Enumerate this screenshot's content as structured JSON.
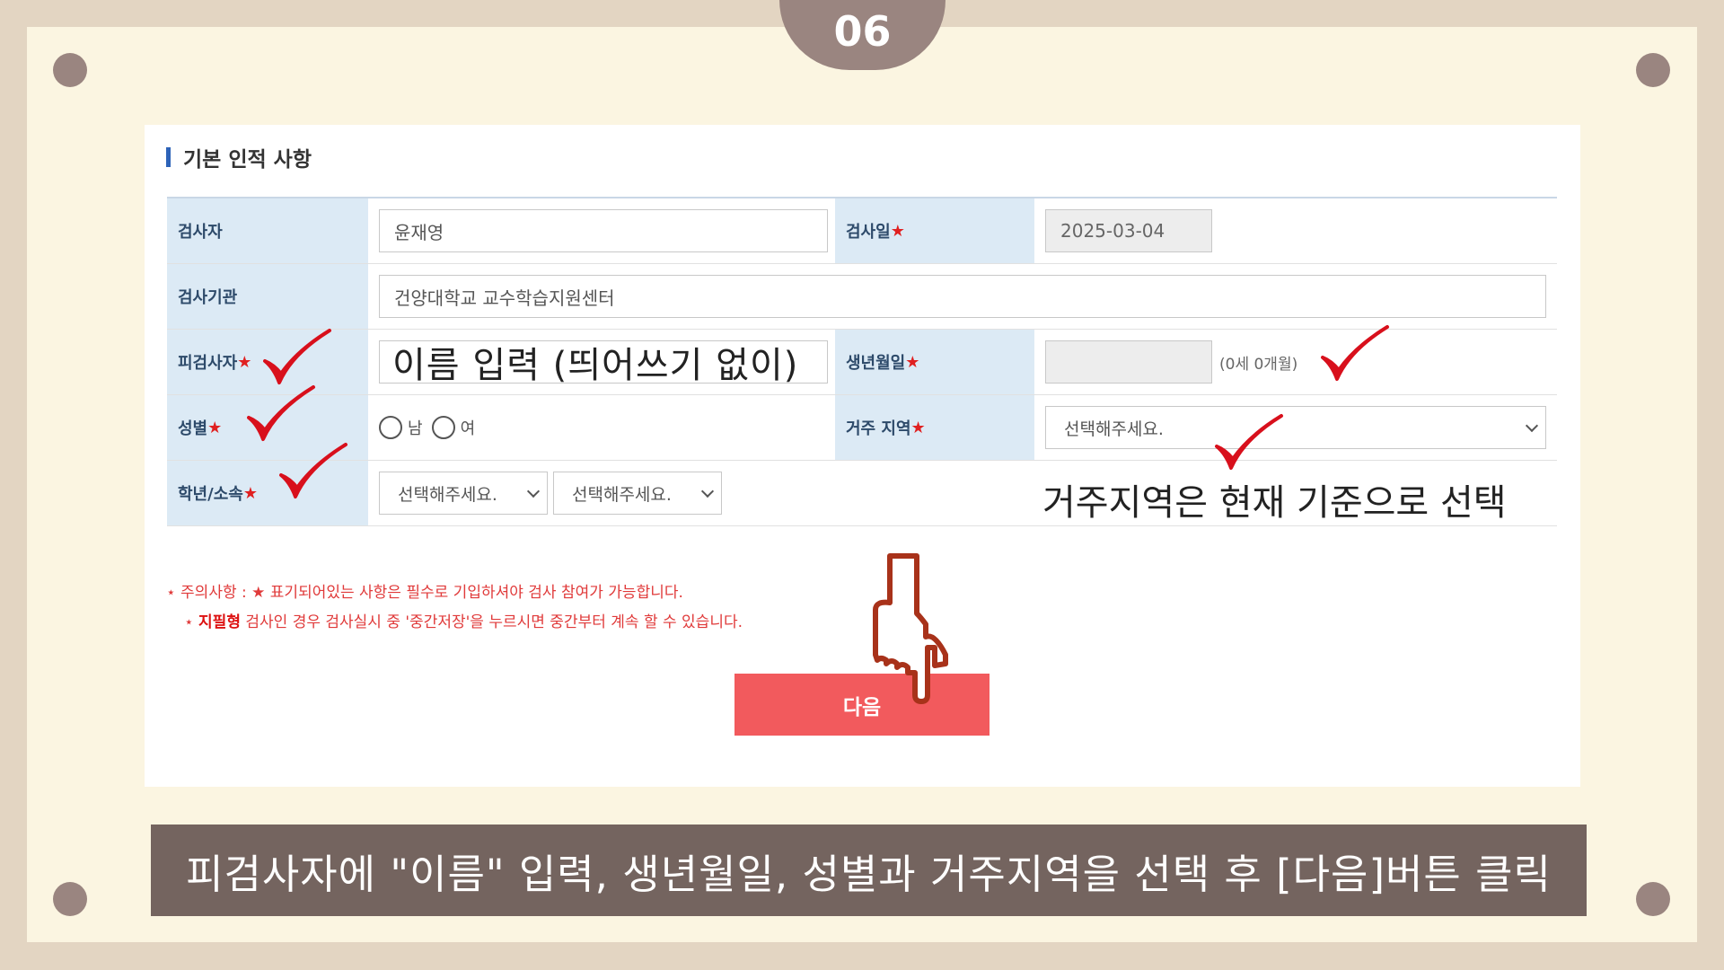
{
  "step_number": "06",
  "section_title": "기본 인적 사항",
  "form": {
    "examiner_label": "검사자",
    "examiner_value": "윤재영",
    "test_date_label": "검사일",
    "test_date_value": "2025-03-04",
    "institution_label": "검사기관",
    "institution_value": "건양대학교 교수학습지원센터",
    "subject_label": "피검사자",
    "subject_value": "이름 입력 (띄어쓰기 없이)",
    "birth_label": "생년월일",
    "birth_value": "",
    "age_text": "(0세 0개월)",
    "gender_label": "성별",
    "gender_options": [
      "남",
      "여"
    ],
    "region_label": "거주 지역",
    "region_selected": "선택해주세요.",
    "grade_label": "학년/소속",
    "grade_select_1": "선택해주세요.",
    "grade_select_2": "선택해주세요.",
    "required_mark": "★"
  },
  "annotation_region": "거주지역은 현재 기준으로 선택",
  "notes": {
    "line1": "⋆ 주의사항 : ★ 표기되어있는 사항은 필수로 기입하셔야 검사 참여가 가능합니다.",
    "line2_prefix": "⋆ ",
    "line2_bold": "지필형",
    "line2_rest": " 검사인 경우 검사실시 중 '중간저장'을 누르시면 중간부터 계속 할 수 있습니다."
  },
  "next_button_label": "다음",
  "caption": "피검사자에 \"이름\" 입력, 생년월일, 성별과 거주지역을 선택 후 [다음]버튼 클릭",
  "colors": {
    "outer_bg": "#e3d5c2",
    "frame_bg": "#fbf5e1",
    "accent_brown": "#9a8580",
    "label_bg": "#dceaf5",
    "next_button": "#f25a5d",
    "caption_bg": "#74645f",
    "check_red": "#d8101c"
  },
  "icons": [
    "checkmark-icon",
    "pointing-hand-icon",
    "chevron-down-icon"
  ]
}
